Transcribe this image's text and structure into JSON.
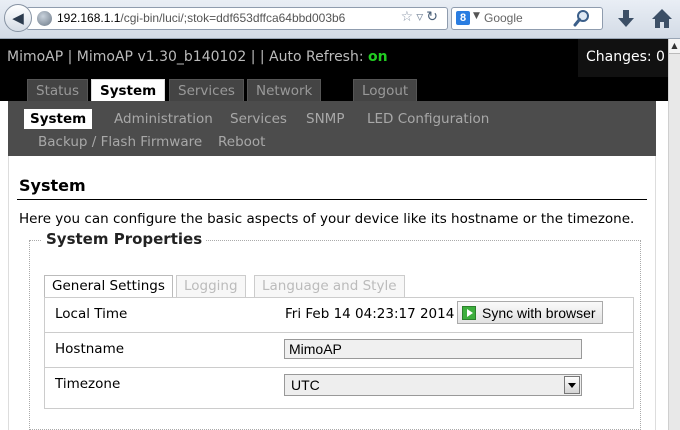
{
  "browser": {
    "url_host": "192.168.1.1",
    "url_path": "/cgi-bin/luci/;stok=ddf653dffca64bbd003b6",
    "search_placeholder": "Google"
  },
  "header": {
    "title_prefix": "MimoAP | MimoAP v1.30_b140102 | | Auto Refresh: ",
    "refresh_state": "on",
    "changes_label": "Changes: 0"
  },
  "main_tabs": [
    "Status",
    "System",
    "Services",
    "Network",
    "Logout"
  ],
  "sub_nav": [
    "System",
    "Administration",
    "Services",
    "SNMP",
    "LED Configuration",
    "Backup / Flash Firmware",
    "Reboot"
  ],
  "content": {
    "title": "System",
    "description": "Here you can configure the basic aspects of your device like its hostname or the timezone.",
    "fieldset_legend": "System Properties",
    "tabs": [
      "General Settings",
      "Logging",
      "Language and Style"
    ],
    "local_time": {
      "label": "Local Time",
      "value": "Fri Feb 14 04:23:17 2014",
      "button": "Sync with browser"
    },
    "hostname": {
      "label": "Hostname",
      "value": "MimoAP"
    },
    "timezone": {
      "label": "Timezone",
      "value": "UTC"
    }
  },
  "colors": {
    "header_bg": "#000000",
    "subnav_bg": "#4c4c4c",
    "refresh_on": "#22cc22"
  }
}
